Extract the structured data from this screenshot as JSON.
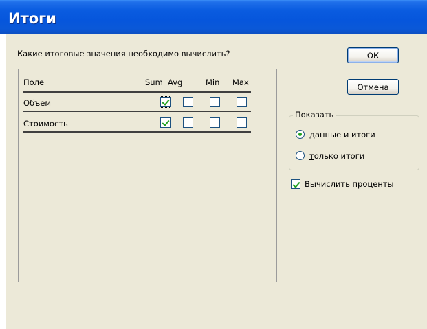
{
  "window": {
    "title": "Итоги"
  },
  "question": "Какие итоговые значения необходимо вычислить?",
  "table": {
    "columns": {
      "field": "Поле",
      "sum": "Sum",
      "avg": "Avg",
      "min": "Min",
      "max": "Max"
    },
    "rows": [
      {
        "label": "Объем",
        "sum": true,
        "avg": false,
        "min": false,
        "max": false
      },
      {
        "label": "Стоимость",
        "sum": true,
        "avg": false,
        "min": false,
        "max": false
      }
    ]
  },
  "buttons": {
    "ok": "ОК",
    "cancel": "Отмена"
  },
  "show_group": {
    "legend": "Показать",
    "options": [
      {
        "label_pre": "",
        "label_u": "д",
        "label_post": "анные и итоги",
        "selected": true
      },
      {
        "label_pre": "",
        "label_u": "т",
        "label_post": "олько итоги",
        "selected": false
      }
    ]
  },
  "percent_checkbox": {
    "label_pre": "В",
    "label_u": "ы",
    "label_post": "числить проценты",
    "checked": true
  },
  "colors": {
    "title_bar": "#0656dc",
    "window_bg": "#ece9d8",
    "check": "#21a121",
    "control_border": "#1c5180"
  }
}
